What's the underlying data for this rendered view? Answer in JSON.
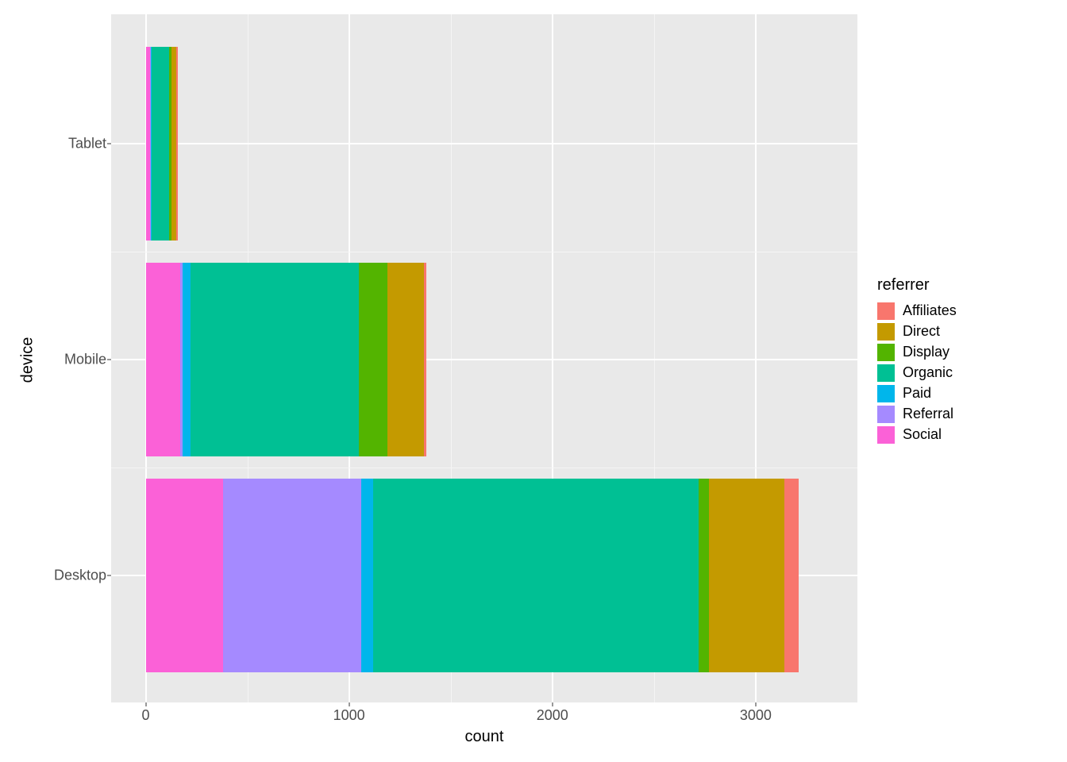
{
  "chart_data": {
    "type": "bar",
    "orientation": "horizontal",
    "stacked": true,
    "xlabel": "count",
    "ylabel": "device",
    "legend_title": "referrer",
    "categories": [
      "Tablet",
      "Mobile",
      "Desktop"
    ],
    "x_ticks": [
      0,
      1000,
      2000,
      3000
    ],
    "xlim": [
      -170,
      3500
    ],
    "stack_order_left_to_right": [
      "Social",
      "Referral",
      "Paid",
      "Organic",
      "Display",
      "Direct",
      "Affiliates"
    ],
    "series": [
      {
        "name": "Affiliates",
        "color": "#F8766D",
        "values": {
          "Tablet": 10,
          "Mobile": 10,
          "Desktop": 70
        }
      },
      {
        "name": "Direct",
        "color": "#C49A00",
        "values": {
          "Tablet": 25,
          "Mobile": 180,
          "Desktop": 370
        }
      },
      {
        "name": "Display",
        "color": "#53B400",
        "values": {
          "Tablet": 10,
          "Mobile": 140,
          "Desktop": 50
        }
      },
      {
        "name": "Organic",
        "color": "#00C094",
        "values": {
          "Tablet": 85,
          "Mobile": 830,
          "Desktop": 1600
        }
      },
      {
        "name": "Paid",
        "color": "#00B6EB",
        "values": {
          "Tablet": 5,
          "Mobile": 40,
          "Desktop": 60
        }
      },
      {
        "name": "Referral",
        "color": "#A58AFF",
        "values": {
          "Tablet": 5,
          "Mobile": 10,
          "Desktop": 680
        }
      },
      {
        "name": "Social",
        "color": "#FB61D7",
        "values": {
          "Tablet": 20,
          "Mobile": 170,
          "Desktop": 380
        }
      }
    ]
  }
}
